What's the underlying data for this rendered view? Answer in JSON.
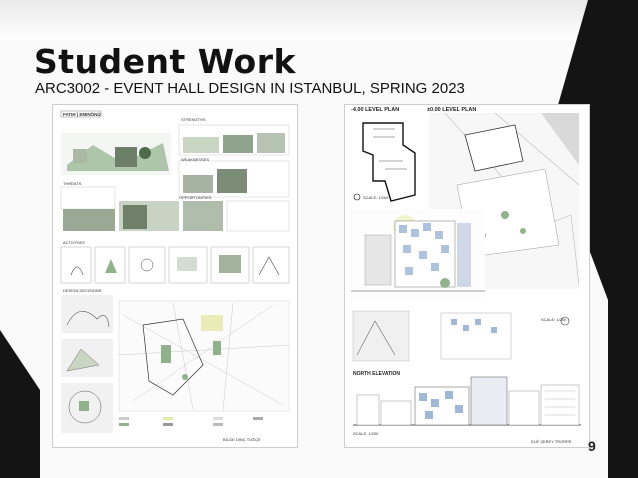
{
  "slide": {
    "title": "Student Work",
    "subtitle": "ARC3002 - EVENT HALL DESIGN IN ISTANBUL, SPRING 2023",
    "page_number": "9"
  },
  "board_left": {
    "header": "FATIH | EMINÖNÜ",
    "section_strengths": "STRENGTHS",
    "section_weaknesses": "WEAKNESSES",
    "section_opportunities": "OPPORTUNITIES",
    "section_threats": "THREATS",
    "section_activities": "ACTIVITIES",
    "section_design_decisions": "DESIGN DECISIONS",
    "credit": "BILGE DİNÇ  TUĞÇE"
  },
  "board_right": {
    "plan_minus4": "-4.00 LEVEL PLAN",
    "plan_zero": "±0.00 LEVEL PLAN",
    "scale_1": "SCALE: 1/200",
    "scale_2": "SCALE: 1/200",
    "north_elevation": "NORTH ELEVATION",
    "scale_3": "SCALE: 1/200",
    "credit": "ELİF ZEREY  TRORPE"
  },
  "colors": {
    "accent_green": "#8fb28a",
    "dark": "#141414"
  }
}
